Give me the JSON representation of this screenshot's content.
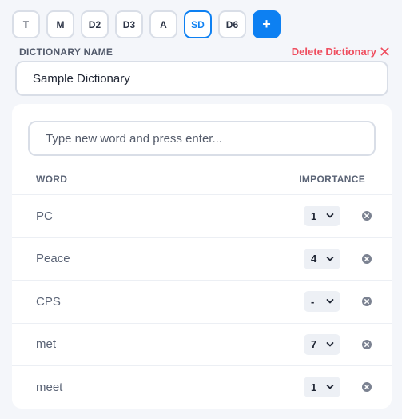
{
  "tabs": [
    {
      "label": "T",
      "active": false
    },
    {
      "label": "M",
      "active": false
    },
    {
      "label": "D2",
      "active": false
    },
    {
      "label": "D3",
      "active": false
    },
    {
      "label": "A",
      "active": false
    },
    {
      "label": "SD",
      "active": true
    },
    {
      "label": "D6",
      "active": false
    }
  ],
  "add_tab_label": "+",
  "dictionary": {
    "name_label": "DICTIONARY NAME",
    "name_value": "Sample Dictionary",
    "delete_label": "Delete Dictionary"
  },
  "new_word": {
    "placeholder": "Type new word and press enter..."
  },
  "table": {
    "col_word": "WORD",
    "col_importance": "IMPORTANCE",
    "rows": [
      {
        "word": "PC",
        "importance": "1"
      },
      {
        "word": "Peace",
        "importance": "4"
      },
      {
        "word": "CPS",
        "importance": "-"
      },
      {
        "word": "met",
        "importance": "7"
      },
      {
        "word": "meet",
        "importance": "1"
      }
    ]
  },
  "icons": {
    "delete_dictionary": "close-x-icon",
    "remove_word": "close-circle-icon",
    "select_arrow": "chevron-down-icon"
  },
  "colors": {
    "accent": "#0d80f2",
    "danger": "#ef4e5f",
    "text_muted": "#5b6476"
  }
}
